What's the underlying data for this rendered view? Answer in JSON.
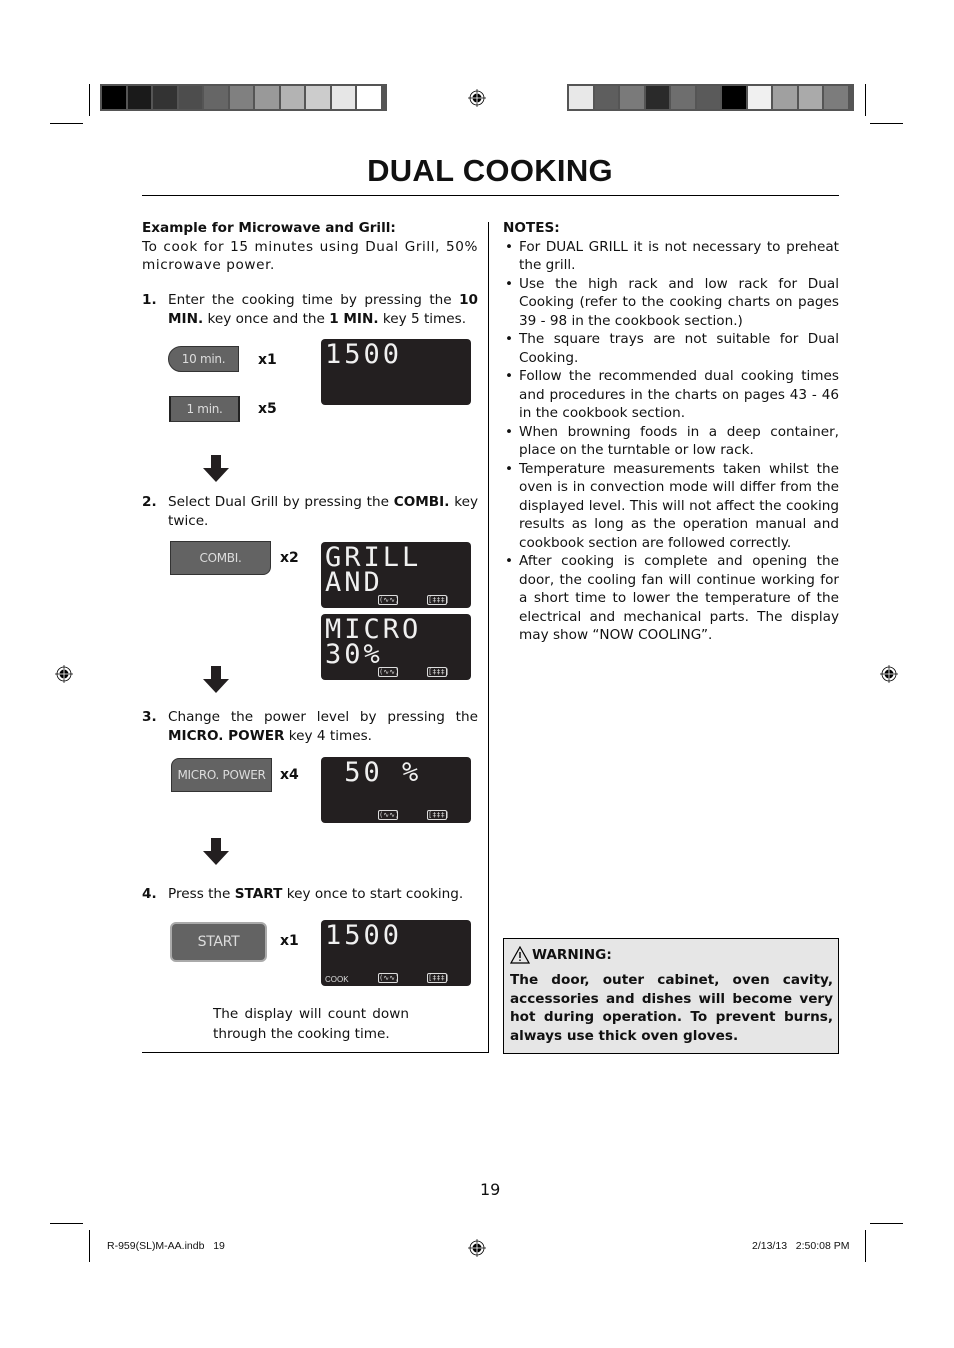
{
  "colorbars": {
    "left": [
      "#000000",
      "#1a1a1a",
      "#333333",
      "#4d4d4d",
      "#666666",
      "#808080",
      "#999999",
      "#b3b3b3",
      "#cccccc",
      "#e6e6e6",
      "#ffffff"
    ],
    "right": [
      "#e8e8e8",
      "#5e5e5e",
      "#7a7a7a",
      "#2a2a2a",
      "#6e6e6e",
      "#5a5a5a",
      "#000000",
      "#f0f0f0",
      "#a0a0a0",
      "#aaaaaa",
      "#7c7c7c"
    ]
  },
  "title": "DUAL COOKING",
  "example": {
    "heading": "Example for Microwave and Grill:",
    "description": "To cook for 15 minutes using Dual Grill, 50% microwave power."
  },
  "steps": [
    {
      "num": "1.",
      "parts": [
        {
          "t": "Enter the cooking time by pressing the ",
          "b": false
        },
        {
          "t": "10 MIN.",
          "b": true
        },
        {
          "t": " key once and the ",
          "b": false
        },
        {
          "t": "1 MIN.",
          "b": true
        },
        {
          "t": " key 5 times.",
          "b": false
        }
      ],
      "keys": [
        {
          "label": "10 min.",
          "multiplier": "x1"
        },
        {
          "label": "1 min.",
          "multiplier": "x5"
        }
      ],
      "displays": [
        {
          "line1": "1500",
          "line2": "",
          "icons": false,
          "cook": ""
        }
      ]
    },
    {
      "num": "2.",
      "parts": [
        {
          "t": "Select Dual Grill by pressing the ",
          "b": false
        },
        {
          "t": "COMBI.",
          "b": true
        },
        {
          "t": " key twice.",
          "b": false
        }
      ],
      "keys": [
        {
          "label": "COMBI.",
          "multiplier": "x2"
        }
      ],
      "displays": [
        {
          "line1": "GRILL",
          "line2": "AND",
          "icons": true,
          "cook": ""
        },
        {
          "line1": "MICRO",
          "line2": "30%",
          "icons": true,
          "cook": ""
        }
      ]
    },
    {
      "num": "3.",
      "parts": [
        {
          "t": "Change the power level by pressing the ",
          "b": false
        },
        {
          "t": "MICRO. POWER",
          "b": true
        },
        {
          "t": " key 4 times.",
          "b": false
        }
      ],
      "keys": [
        {
          "label": "MICRO. POWER",
          "multiplier": "x4"
        }
      ],
      "displays": [
        {
          "line1": " 50 %",
          "line2": "",
          "icons": true,
          "cook": ""
        }
      ]
    },
    {
      "num": "4.",
      "parts": [
        {
          "t": "Press the ",
          "b": false
        },
        {
          "t": "START",
          "b": true
        },
        {
          "t": " key once to start cooking.",
          "b": false
        }
      ],
      "keys": [
        {
          "label": "START",
          "multiplier": "x1"
        }
      ],
      "displays": [
        {
          "line1": "1500",
          "line2": "",
          "icons": true,
          "cook": "COOK"
        }
      ]
    }
  ],
  "lcd_icons": {
    "micro": "(∿∿)",
    "grill": "[‡‡‡]"
  },
  "countdown_note": "The display will count down through the cooking time.",
  "notes": {
    "heading": "NOTES:",
    "items": [
      "For DUAL GRILL it is not necessary to preheat the grill.",
      "Use the high rack and low rack for Dual Cooking (refer to the cooking charts on pages 39 - 98 in the cookbook section.)",
      "The square trays are not suitable for Dual Cooking.",
      "Follow the recommended dual cooking times and procedures in the charts on pages 43 - 46 in the cookbook section.",
      "When browning foods in a deep container, place on the turntable or low rack.",
      "Temperature measurements taken whilst the oven is in convection mode will differ from the displayed level. This will not affect the cooking results as long as the operation manual and cookbook section are followed correctly.",
      "After cooking is complete and opening the door, the cooling fan will continue working for a short time to lower the temperature of the electrical and mechanical parts. The display may show “NOW COOLING”."
    ]
  },
  "warning": {
    "heading": "WARNING:",
    "text": "The door, outer cabinet, oven cavity, accessories and dishes will become very hot during operation. To prevent burns, always use thick oven gloves."
  },
  "page_number": "19",
  "footer": {
    "file": "R-959(SL)M-AA.indb   19",
    "timestamp": "2/13/13   2:50:08 PM"
  }
}
